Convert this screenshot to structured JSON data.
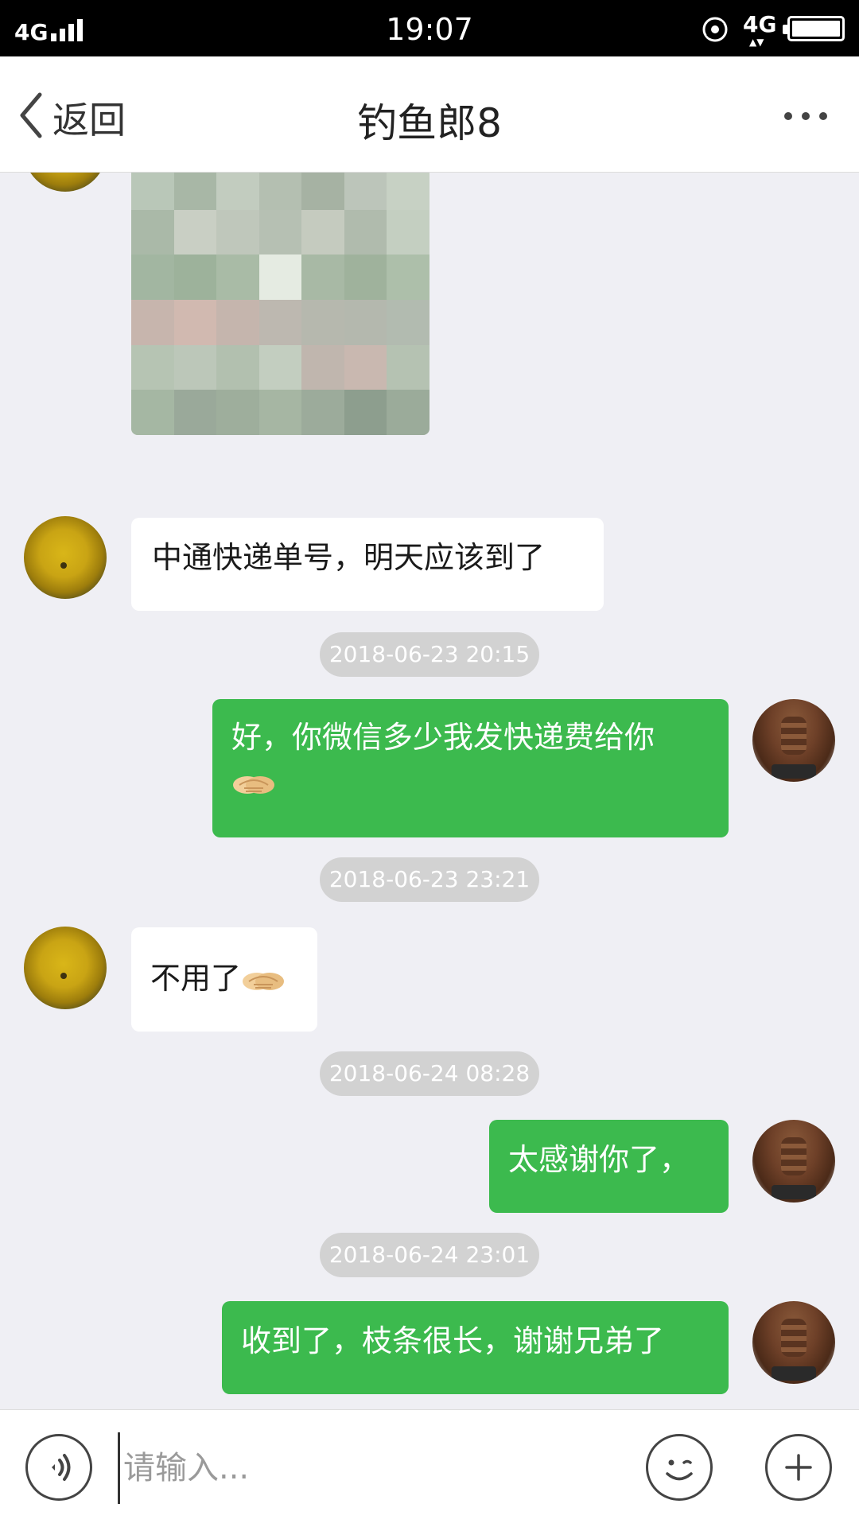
{
  "status_bar": {
    "network_left": "4G",
    "time": "19:07",
    "network_right": "4G",
    "network_arrows": "▲▼"
  },
  "nav": {
    "back_label": "返回",
    "title": "钓鱼郎8"
  },
  "messages": [
    {
      "id": "photo",
      "direction": "incoming",
      "type": "image",
      "avatar": "yellow-fruit-avatar"
    },
    {
      "id": "m1",
      "direction": "incoming",
      "type": "text",
      "text": "中通快递单号，明天应该到了"
    },
    {
      "id": "t1",
      "type": "timestamp",
      "text": "2018-06-23 20:15"
    },
    {
      "id": "m2",
      "direction": "outgoing",
      "type": "text",
      "text": "好，你微信多少我发快递费给你",
      "emoji": "handshake-emoji"
    },
    {
      "id": "t2",
      "type": "timestamp",
      "text": "2018-06-23 23:21"
    },
    {
      "id": "m3",
      "direction": "incoming",
      "type": "text",
      "text": "不用了",
      "emoji": "handshake-emoji"
    },
    {
      "id": "t3",
      "type": "timestamp",
      "text": "2018-06-24 08:28"
    },
    {
      "id": "m4",
      "direction": "outgoing",
      "type": "text",
      "text": "太感谢你了，"
    },
    {
      "id": "t4",
      "type": "timestamp",
      "text": "2018-06-24 23:01"
    },
    {
      "id": "m5",
      "direction": "outgoing",
      "type": "text",
      "text": "收到了，枝条很长，谢谢兄弟了"
    }
  ],
  "input": {
    "placeholder": "请输入..."
  },
  "colors": {
    "outgoing_bubble": "#3cba4e",
    "incoming_bubble": "#ffffff",
    "background": "#efeff4",
    "timestamp_pill": "#d2d2d2"
  },
  "icons": [
    "back-chevron-icon",
    "more-icon",
    "voice-icon",
    "emoji-icon",
    "plus-icon",
    "handshake-emoji"
  ]
}
